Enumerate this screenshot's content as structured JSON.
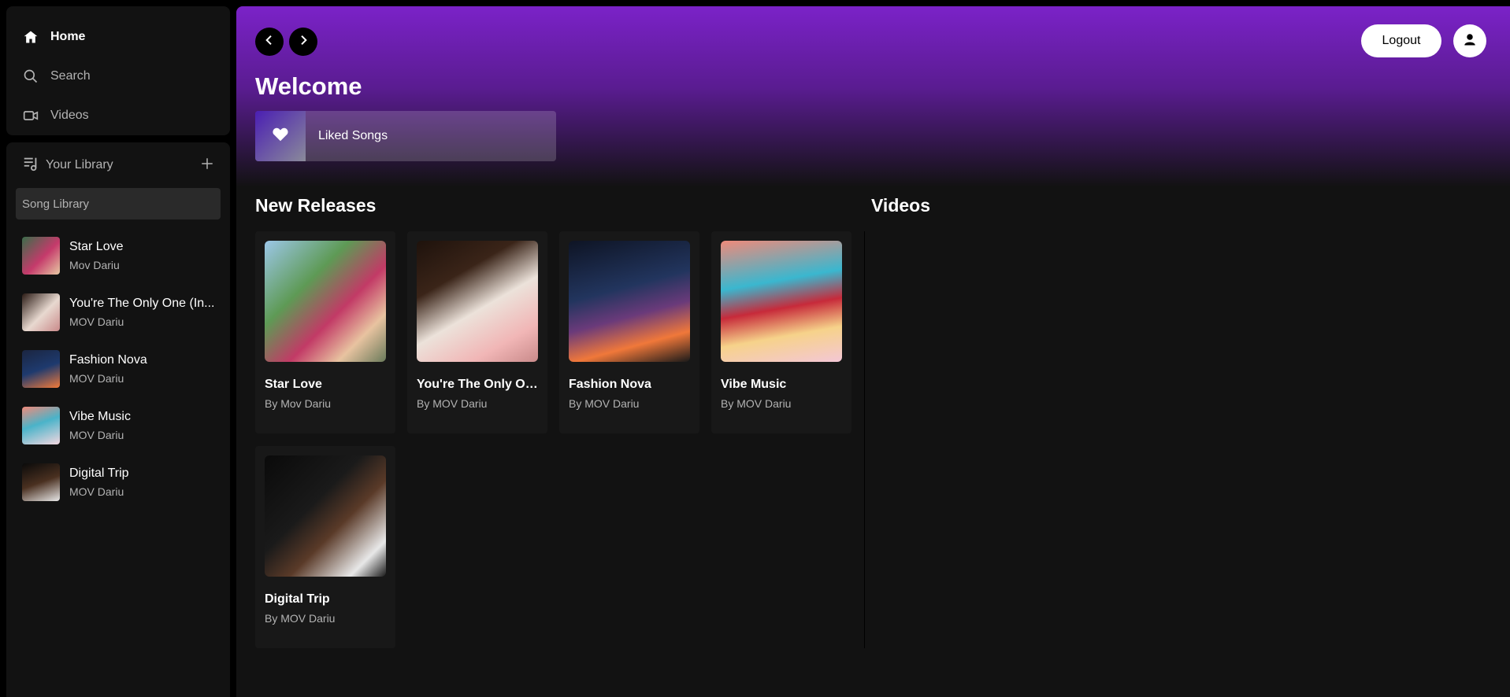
{
  "nav": {
    "items": [
      {
        "label": "Home",
        "icon": "home-icon",
        "active": true
      },
      {
        "label": "Search",
        "icon": "search-icon",
        "active": false
      },
      {
        "label": "Videos",
        "icon": "video-icon",
        "active": false
      }
    ]
  },
  "library": {
    "title": "Your Library",
    "search_placeholder": "Song Library",
    "items": [
      {
        "title": "Star Love",
        "artist": "Mov Dariu"
      },
      {
        "title": "You're The Only One (In...",
        "artist": "MOV Dariu"
      },
      {
        "title": "Fashion Nova",
        "artist": "MOV Dariu"
      },
      {
        "title": "Vibe Music",
        "artist": "MOV Dariu"
      },
      {
        "title": "Digital Trip",
        "artist": "MOV Dariu"
      }
    ]
  },
  "header": {
    "welcome": "Welcome",
    "logout_label": "Logout",
    "liked_songs": "Liked Songs"
  },
  "sections": {
    "new_releases": "New Releases",
    "videos": "Videos"
  },
  "releases": [
    {
      "title": "Star Love",
      "artist": "By Mov Dariu"
    },
    {
      "title": "You're The Only On...",
      "artist": "By MOV Dariu"
    },
    {
      "title": "Fashion Nova",
      "artist": "By MOV Dariu"
    },
    {
      "title": "Vibe Music",
      "artist": "By MOV Dariu"
    },
    {
      "title": "Digital Trip",
      "artist": "By MOV Dariu"
    }
  ],
  "colors": {
    "accent": "#7b22c8",
    "background": "#121212",
    "card": "#181818"
  }
}
